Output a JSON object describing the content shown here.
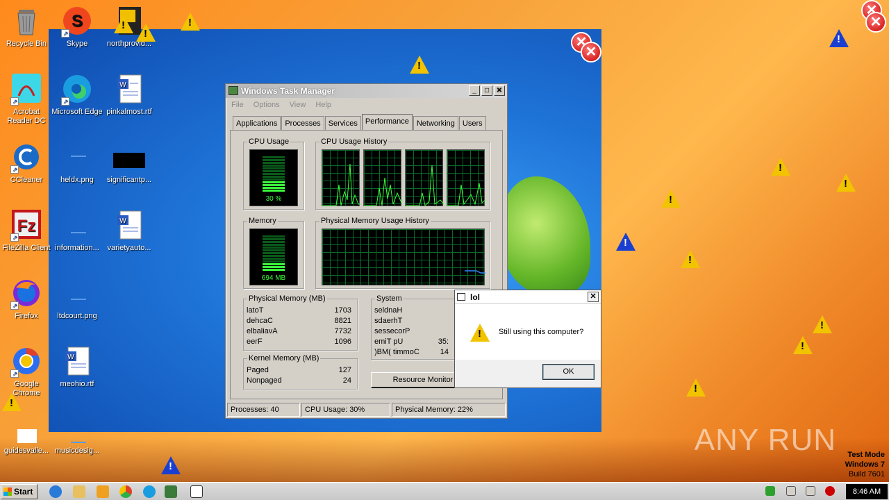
{
  "desktop": {
    "icons": [
      {
        "label": "Recycle Bin"
      },
      {
        "label": "Skype"
      },
      {
        "label": "northprovid..."
      },
      {
        "label": "Acrobat Reader DC"
      },
      {
        "label": "Microsoft Edge"
      },
      {
        "label": "pinkalmost.rtf"
      },
      {
        "label": "CCleaner"
      },
      {
        "label": "heldx.png"
      },
      {
        "label": "significantp..."
      },
      {
        "label": "FileZilla Client"
      },
      {
        "label": "information..."
      },
      {
        "label": "varietyauto..."
      },
      {
        "label": "Firefox"
      },
      {
        "label": "ltdcourt.png"
      },
      {
        "label": "Google Chrome"
      },
      {
        "label": "meohio.rtf"
      },
      {
        "label": "guidesvalle..."
      },
      {
        "label": "musicdesig..."
      }
    ]
  },
  "task_manager": {
    "title": "Windows Task Manager",
    "menu": [
      "File",
      "Options",
      "View",
      "Help"
    ],
    "tabs": [
      "Applications",
      "Processes",
      "Services",
      "Performance",
      "Networking",
      "Users"
    ],
    "active_tab": "Performance",
    "cpu_usage_label": "CPU Usage",
    "cpu_usage_value": "30 %",
    "cpu_history_label": "CPU Usage History",
    "memory_label": "Memory",
    "memory_value": "694 MB",
    "phys_history_label": "Physical Memory Usage History",
    "physical_memory": {
      "label": "Physical Memory (MB)",
      "rows": [
        {
          "name": "latoT",
          "value": "1703"
        },
        {
          "name": "dehcaC",
          "value": "8821"
        },
        {
          "name": "elbaliavA",
          "value": "7732"
        },
        {
          "name": "eerF",
          "value": "1096"
        }
      ]
    },
    "system": {
      "label": "System",
      "rows": [
        {
          "name": "seldnaH",
          "value": ""
        },
        {
          "name": "sdaerhT",
          "value": ""
        },
        {
          "name": "sessecorP",
          "value": ""
        },
        {
          "name": "emiT pU",
          "value": "35:"
        },
        {
          "name": ")BM( timmoC",
          "value": "14"
        }
      ]
    },
    "kernel_memory": {
      "label": "Kernel Memory (MB)",
      "rows": [
        {
          "name": "Paged",
          "value": "127"
        },
        {
          "name": "Nonpaged",
          "value": "24"
        }
      ]
    },
    "resource_monitor_button": "Resource Monitor",
    "status": {
      "processes": "Processes: 40",
      "cpu": "CPU Usage: 30%",
      "memory": "Physical Memory: 22%"
    }
  },
  "message_box": {
    "title": "lol",
    "text": "Still using this computer?",
    "ok_label": "OK"
  },
  "taskbar": {
    "start_label": "Start",
    "clock": "8:46 AM"
  },
  "watermark": "ANY RUN",
  "testmode": {
    "line1": "Test Mode",
    "line2": "Windows 7",
    "line3": "Build 7601"
  },
  "colors": {
    "graph_green": "#3cff3c",
    "warn_yellow": "#f2c300",
    "warn_blue": "#1a3fd0",
    "desktop_blue": "#1f74d8"
  }
}
